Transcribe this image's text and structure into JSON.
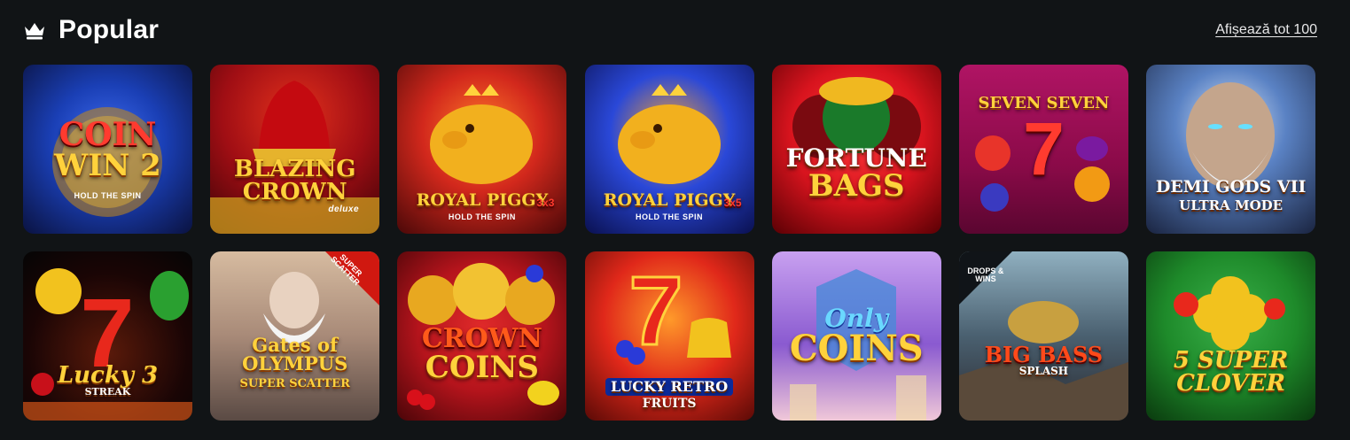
{
  "section": {
    "title": "Popular",
    "see_all_label": "Afișează tot 100"
  },
  "games": [
    {
      "key": "coin-win-2",
      "line1": "COIN",
      "line2": "WIN 2",
      "sub": "HOLD THE SPIN",
      "bg": [
        "#1a3fb5",
        "#0a1240"
      ]
    },
    {
      "key": "blazing-crown",
      "line1": "BLAZING",
      "line2": "CROWN",
      "sub": "deluxe",
      "bg": [
        "#c8141a",
        "#4a0508"
      ]
    },
    {
      "key": "royal-piggy-3x3",
      "line1": "ROYAL PIGGY",
      "line2": "3x3",
      "sub": "HOLD THE SPIN",
      "bg": [
        "#d2281c",
        "#5a0a0a"
      ]
    },
    {
      "key": "royal-piggy-3x5",
      "line1": "ROYAL PIGGY",
      "line2": "3x5",
      "sub": "HOLD THE SPIN",
      "bg": [
        "#2a48d8",
        "#0a1460"
      ]
    },
    {
      "key": "fortune-bags",
      "line1": "FORTUNE",
      "line2": "BAGS",
      "sub": "",
      "bg": [
        "#d8141e",
        "#6a0006"
      ]
    },
    {
      "key": "seven-seven",
      "line1": "SEVEN SEVEN",
      "line2": "7",
      "sub": "",
      "bg": [
        "#a01058",
        "#5a0630"
      ]
    },
    {
      "key": "demi-gods-vii",
      "line1": "DEMI GODS VII",
      "line2": "ULTRA MODE",
      "sub": "",
      "bg": [
        "#4c6fb0",
        "#1a2240"
      ]
    },
    {
      "key": "lucky-streak-3",
      "line1": "Lucky 3",
      "line2": "STREAK",
      "sub": "",
      "bg": [
        "#2a0a0a",
        "#050505"
      ]
    },
    {
      "key": "gates-of-olympus",
      "line1": "Gates of OLYMPUS",
      "line2": "SUPER SCATTER",
      "sub": "",
      "badge": "SUPER SCATTER",
      "bg": [
        "#c9a987",
        "#6e5a4e"
      ]
    },
    {
      "key": "crown-coins",
      "line1": "CROWN",
      "line2": "COINS",
      "sub": "",
      "bg": [
        "#b5141c",
        "#4a0508"
      ]
    },
    {
      "key": "lucky-retro-fruits",
      "line1": "LUCKY RETRO",
      "line2": "FRUITS",
      "sub": "",
      "bg": [
        "#e0281a",
        "#5a0a06"
      ]
    },
    {
      "key": "only-coins",
      "line1": "Only",
      "line2": "COINS",
      "sub": "",
      "bg": [
        "#b48ae0",
        "#5a3aa0"
      ]
    },
    {
      "key": "big-bass-splash",
      "line1": "BIG BASS",
      "line2": "SPLASH",
      "sub": "",
      "badge": "DROPS & WINS",
      "bg": [
        "#6f8ea0",
        "#2a3440"
      ]
    },
    {
      "key": "5-super-clover",
      "line1": "5 SUPER",
      "line2": "CLOVER",
      "sub": "",
      "bg": [
        "#1e8a2a",
        "#0a3a0e"
      ]
    }
  ],
  "colors": {
    "background": "#111416",
    "title": "#ffffff",
    "link": "#e9e9ea"
  },
  "icons": {
    "section": "crown-icon"
  }
}
